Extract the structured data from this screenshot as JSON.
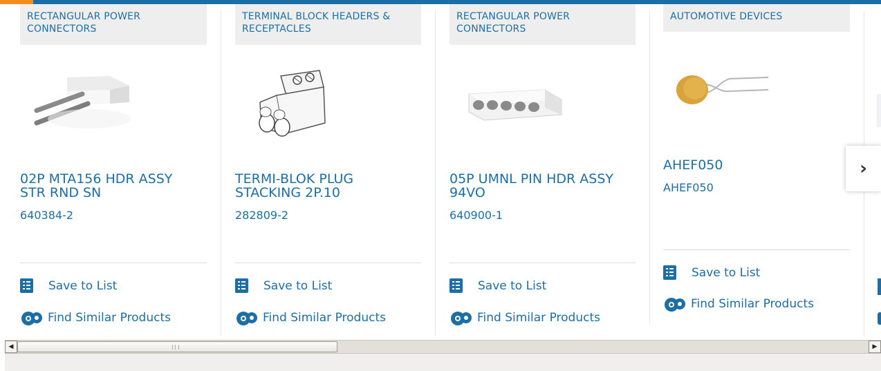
{
  "cards": [
    {
      "category": "RECTANGULAR POWER CONNECTORS",
      "title": "02P MTA156 HDR ASSY STR RND SN",
      "part_number": "640384-2",
      "save": "Save to List",
      "find": "Find Similar Products"
    },
    {
      "category": "TERMINAL BLOCK HEADERS & RECEPTACLES",
      "title": "TERMI-BLOK PLUG STACKING 2P.10",
      "part_number": "282809-2",
      "save": "Save to List",
      "find": "Find Similar Products"
    },
    {
      "category": "RECTANGULAR POWER CONNECTORS",
      "title": "05P UMNL PIN HDR ASSY 94VO",
      "part_number": "640900-1",
      "save": "Save to List",
      "find": "Find Similar Products"
    },
    {
      "category": "AUTOMOTIVE DEVICES",
      "title": "AHEF050",
      "part_number": "AHEF050",
      "save": "Save to List",
      "find": "Find Similar Products"
    }
  ],
  "colors": {
    "brand_blue": "#1b6fa6",
    "accent_orange": "#f28c1c",
    "card_header_bg": "#eeeeee"
  },
  "icons": {
    "next": "chevron-right-icon",
    "save": "checklist-icon",
    "find": "gear-cluster-icon"
  },
  "next_glyph": "›"
}
